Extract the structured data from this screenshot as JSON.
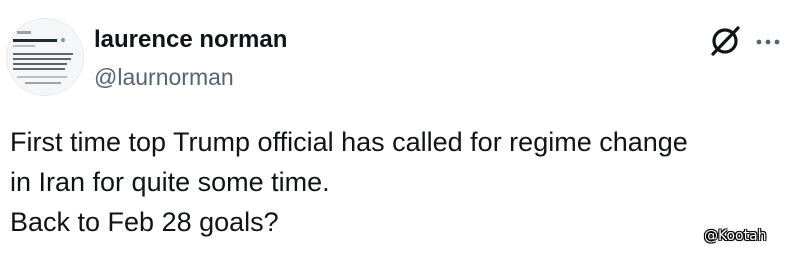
{
  "tweet": {
    "author": {
      "display_name": "laurence norman",
      "handle": "@laurnorman",
      "avatar": "profile-card-thumbnail"
    },
    "header_icons": [
      "grok-icon",
      "more-icon"
    ],
    "text_lines": [
      "First time top Trump official has called for regime change",
      "in Iran for quite some time.",
      "Back to Feb 28 goals?"
    ]
  },
  "watermark": "@Kootah",
  "colors": {
    "text": "#0f1419",
    "secondary_text": "#536471",
    "background": "#ffffff"
  }
}
